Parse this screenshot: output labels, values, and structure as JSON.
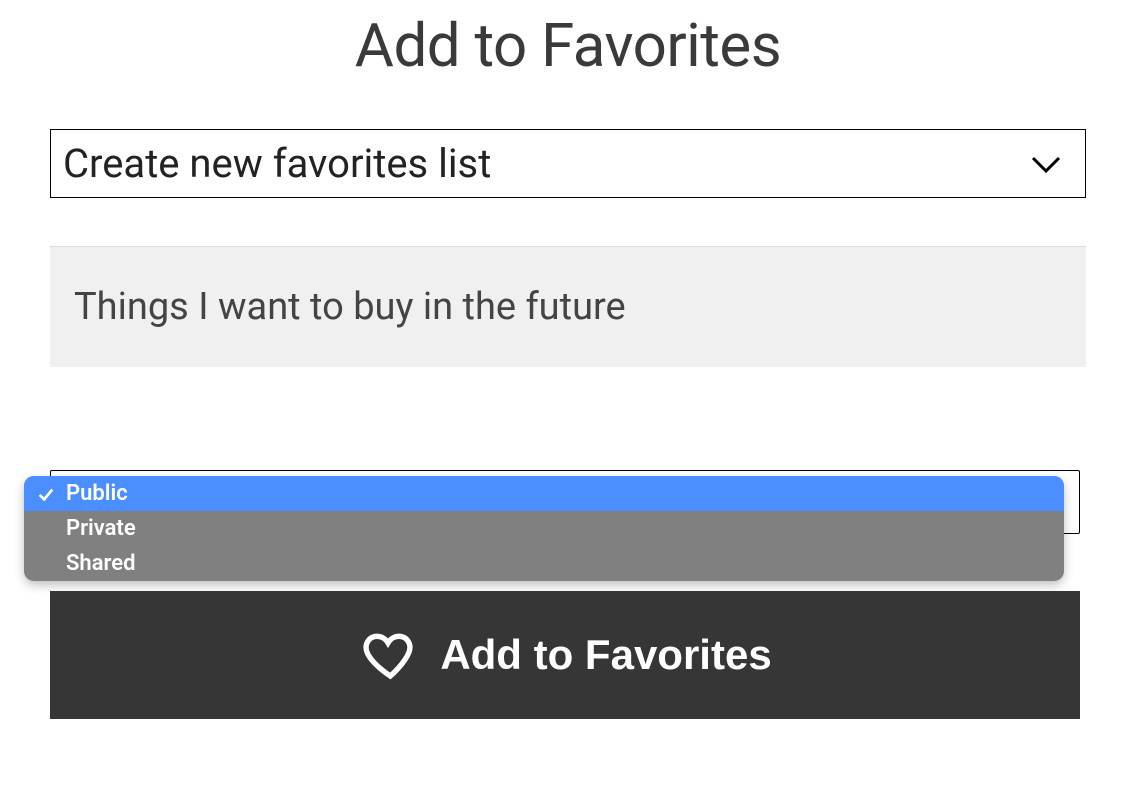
{
  "title": "Add to Favorites",
  "list_select": {
    "selected_label": "Create new favorites list"
  },
  "name_input": {
    "value": "Things I want to buy in the future"
  },
  "visibility": {
    "options": [
      {
        "label": "Public",
        "selected": true
      },
      {
        "label": "Private",
        "selected": false
      },
      {
        "label": "Shared",
        "selected": false
      }
    ]
  },
  "add_button": {
    "label": "Add to Favorites"
  }
}
